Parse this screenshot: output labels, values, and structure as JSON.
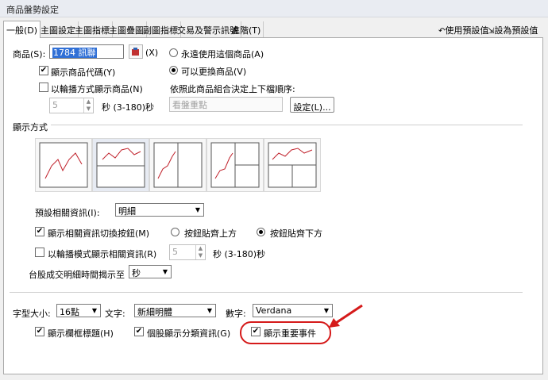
{
  "window": {
    "title": "商品盤勢設定"
  },
  "tabs": [
    {
      "label": "一般(D)",
      "active": true
    },
    {
      "label": "主圖設定",
      "active": false
    },
    {
      "label": "主圖指標",
      "active": false
    },
    {
      "label": "主圖疊圖",
      "active": false
    },
    {
      "label": "副圖指標",
      "active": false
    },
    {
      "label": "交易及警示訊號",
      "active": false
    },
    {
      "label": "進階(T)",
      "active": false
    }
  ],
  "top_actions": {
    "use_default": "使用預設值",
    "set_default": "設為預設值"
  },
  "product": {
    "label": "商品(S):",
    "value": "1784 訊聯",
    "x_button": "(X)",
    "show_code_label": "顯示商品代碼(Y)",
    "show_code_checked": true,
    "rotate_label": "以輪播方式顯示商品(N)",
    "rotate_checked": false,
    "rotate_seconds": "5",
    "rotate_unit": "秒 (3-180)秒"
  },
  "change_mode": {
    "fixed_label": "永遠使用這個商品(A)",
    "fixed_selected": false,
    "changeable_label": "可以更換商品(V)",
    "changeable_selected": true,
    "order_label": "依照此商品組合決定上下檔順序:",
    "order_value": "看盤重點",
    "settings_button": "設定(L)..."
  },
  "display": {
    "section_title": "顯示方式",
    "layouts": [
      "single-chart",
      "top-main-bottom-sub",
      "left-right-split",
      "left-main-right-two",
      "top-main-bottom-two"
    ],
    "related_info_label": "預設相關資訊(I):",
    "related_info_value": "明細",
    "toggle_button_label": "顯示相關資訊切換按鈕(M)",
    "toggle_button_checked": true,
    "position_top_label": "按鈕貼齊上方",
    "position_top_selected": false,
    "position_bottom_label": "按鈕貼齊下方",
    "position_bottom_selected": true,
    "rotate_info_label": "以輪播模式顯示相關資訊(R)",
    "rotate_info_checked": false,
    "rotate_info_seconds": "5",
    "rotate_info_unit": "秒 (3-180)秒",
    "timestamp_label": "台股成交明細時間揭示至",
    "timestamp_value": "秒"
  },
  "font": {
    "size_label": "字型大小:",
    "size_value": "16點",
    "text_label": "文字:",
    "text_value": "新細明體",
    "number_label": "數字:",
    "number_value": "Verdana"
  },
  "bottom_checks": {
    "show_column_title": "顯示欄框標題(H)",
    "show_column_title_checked": true,
    "show_category_info": "個股顯示分類資訊(G)",
    "show_category_info_checked": true,
    "show_major_events": "顯示重要事件",
    "show_major_events_checked": true
  },
  "colors": {
    "annotation": "#d51a1a",
    "selection": "#3170d6",
    "chart_line": "#c0202a"
  }
}
